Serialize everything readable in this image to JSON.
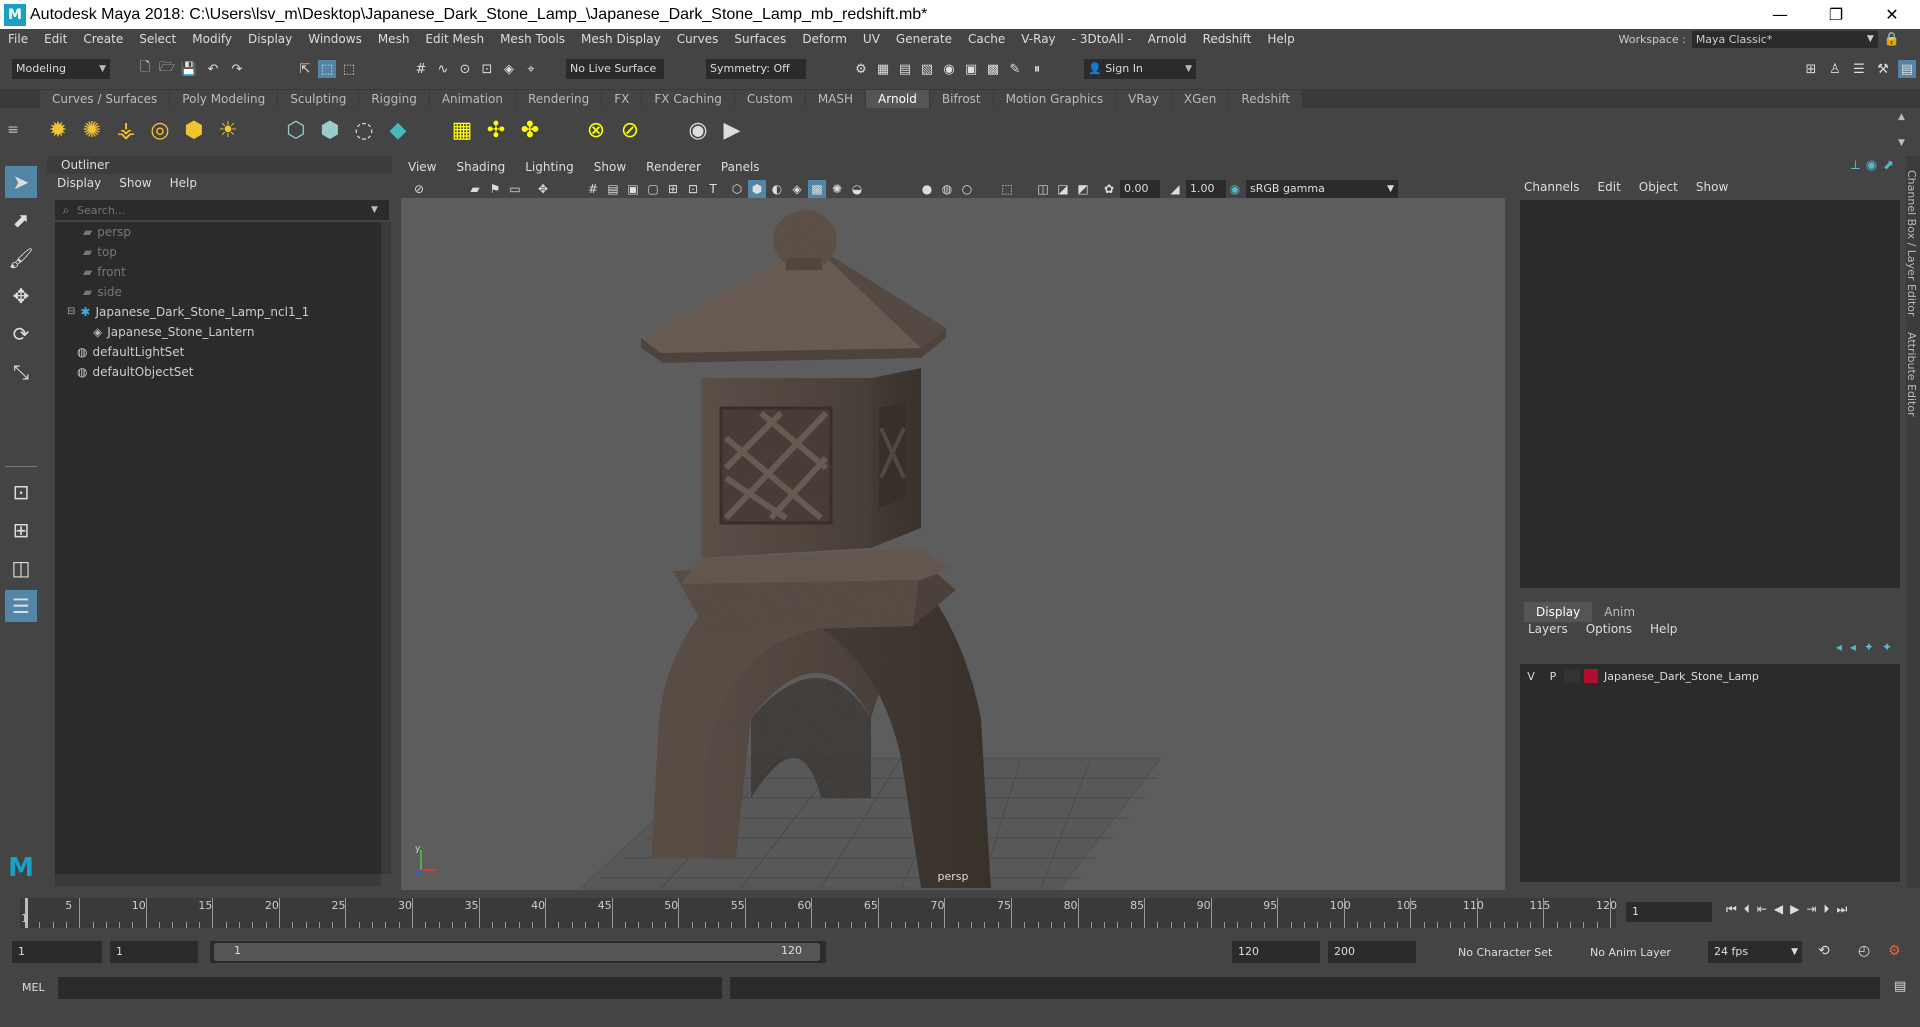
{
  "window": {
    "title": "Autodesk Maya 2018: C:\\Users\\lsv_m\\Desktop\\Japanese_Dark_Stone_Lamp_\\Japanese_Dark_Stone_Lamp_mb_redshift.mb*",
    "logo_letter": "M",
    "minimize": "—",
    "maximize": "❐",
    "close": "✕"
  },
  "menubar": [
    "File",
    "Edit",
    "Create",
    "Select",
    "Modify",
    "Display",
    "Windows",
    "Mesh",
    "Edit Mesh",
    "Mesh Tools",
    "Mesh Display",
    "Curves",
    "Surfaces",
    "Deform",
    "UV",
    "Generate",
    "Cache",
    "V-Ray",
    "- 3DtoAll -",
    "Arnold",
    "Redshift",
    "Help"
  ],
  "workspace": {
    "label": "Workspace :",
    "value": "Maya Classic*"
  },
  "statusline": {
    "mode": "Modeling",
    "live_surface": "No Live Surface",
    "symmetry": "Symmetry: Off",
    "sign_in": "Sign In"
  },
  "shelf_tabs": [
    "Curves / Surfaces",
    "Poly Modeling",
    "Sculpting",
    "Rigging",
    "Animation",
    "Rendering",
    "FX",
    "FX Caching",
    "Custom",
    "MASH",
    "Arnold",
    "Bifrost",
    "Motion Graphics",
    "VRay",
    "XGen",
    "Redshift"
  ],
  "shelf_active_tab": "Arnold",
  "outliner": {
    "title": "Outliner",
    "menu": [
      "Display",
      "Show",
      "Help"
    ],
    "search_placeholder": "Search...",
    "nodes": [
      {
        "label": "persp",
        "dim": true
      },
      {
        "label": "top",
        "dim": true
      },
      {
        "label": "front",
        "dim": true
      },
      {
        "label": "side",
        "dim": true
      },
      {
        "label": "Japanese_Dark_Stone_Lamp_ncl1_1",
        "dim": false
      },
      {
        "label": "Japanese_Stone_Lantern",
        "dim": false
      },
      {
        "label": "defaultLightSet",
        "dim": false
      },
      {
        "label": "defaultObjectSet",
        "dim": false
      }
    ]
  },
  "viewport": {
    "menu": [
      "View",
      "Shading",
      "Lighting",
      "Show",
      "Renderer",
      "Panels"
    ],
    "exposure": "0.00",
    "gamma": "1.00",
    "color_space": "sRGB gamma",
    "camera_label": "persp"
  },
  "channelbox": {
    "menu": [
      "Channels",
      "Edit",
      "Object",
      "Show"
    ]
  },
  "layer_editor": {
    "tabs": [
      "Display",
      "Anim"
    ],
    "menu": [
      "Layers",
      "Options",
      "Help"
    ],
    "layer": {
      "v": "V",
      "p": "P",
      "name": "Japanese_Dark_Stone_Lamp",
      "color": "#b01030"
    }
  },
  "side_tabs": [
    "Channel Box / Layer Editor",
    "Attribute Editor"
  ],
  "timeline": {
    "ticks": [
      5,
      10,
      15,
      20,
      25,
      30,
      35,
      40,
      45,
      50,
      55,
      60,
      65,
      70,
      75,
      80,
      85,
      90,
      95,
      100,
      105,
      110,
      115,
      120
    ],
    "start_label": "1",
    "current_frame": "1",
    "max": 120
  },
  "range": {
    "start": "1",
    "playback_start": "1",
    "slider_start": "1",
    "slider_end": "120",
    "playback_end": "120",
    "end": "200",
    "character_set": "No Character Set",
    "anim_layer": "No Anim Layer",
    "fps": "24 fps"
  },
  "cmdline": {
    "label": "MEL"
  },
  "colors": {
    "bg": "#444444",
    "panel_dark": "#2b2b2b",
    "viewport": "#5d5d5d",
    "accent": "#5285a6"
  }
}
